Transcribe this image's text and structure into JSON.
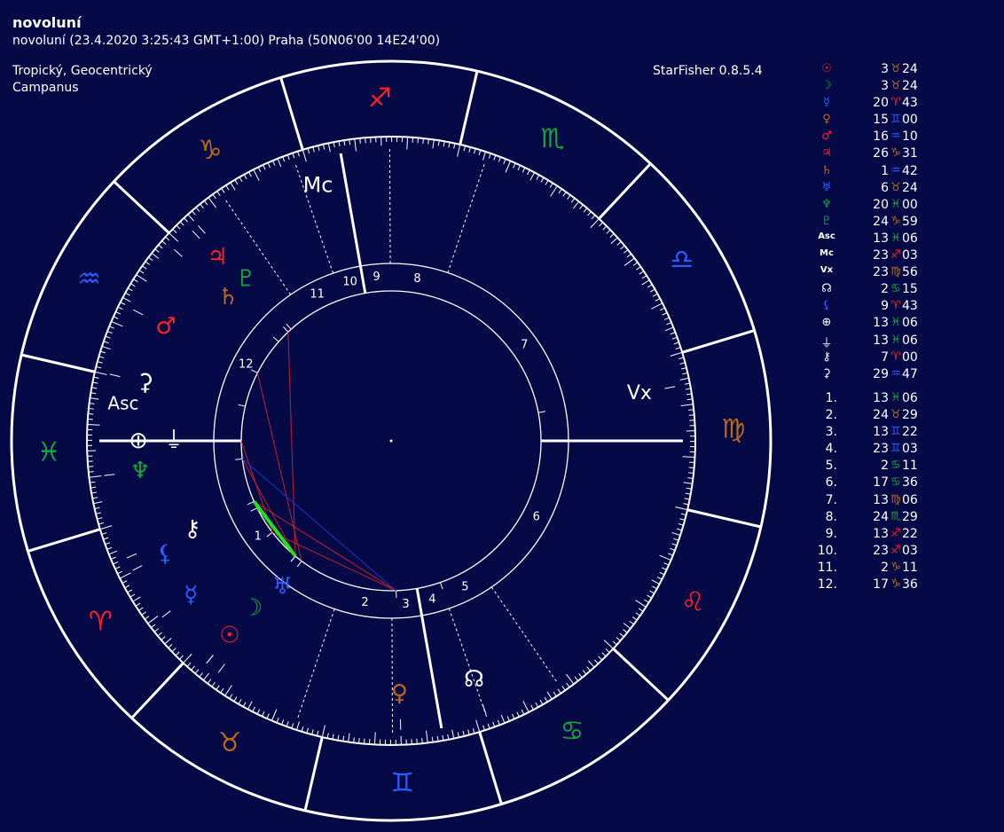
{
  "header": {
    "title": "novoluní",
    "subtitle": "novoluní  (23.4.2020 3:25:43 GMT+1:00) Praha (50N06'00 14E24'00)",
    "zodiac_system": "Tropický, Geocentrický",
    "house_system": "Campanus",
    "app": "StarFisher 0.8.5.4"
  },
  "colors": {
    "background": "#050a46",
    "fire": "#ff2020",
    "earth": "#b86a1a",
    "air": "#2a5cff",
    "water": "#16a63a",
    "aspect_hard": "#c0202a",
    "aspect_soft": "#2030c8",
    "aspect_conj": "#22e022"
  },
  "signs": [
    {
      "glyph": "♈",
      "name": "Beran",
      "color": "#ff2020"
    },
    {
      "glyph": "♉",
      "name": "Býk",
      "color": "#b86a1a"
    },
    {
      "glyph": "♊",
      "name": "Blíženci",
      "color": "#2a5cff"
    },
    {
      "glyph": "♋",
      "name": "Rak",
      "color": "#16a63a"
    },
    {
      "glyph": "♌",
      "name": "Lev",
      "color": "#ff2020"
    },
    {
      "glyph": "♍",
      "name": "Panna",
      "color": "#b86a1a"
    },
    {
      "glyph": "♎",
      "name": "Váhy",
      "color": "#2a5cff"
    },
    {
      "glyph": "♏",
      "name": "Štír",
      "color": "#16a63a"
    },
    {
      "glyph": "♐",
      "name": "Střelec",
      "color": "#ff2020"
    },
    {
      "glyph": "♑",
      "name": "Kozoroh",
      "color": "#b86a1a"
    },
    {
      "glyph": "♒",
      "name": "Vodnář",
      "color": "#2a5cff"
    },
    {
      "glyph": "♓",
      "name": "Ryby",
      "color": "#16a63a"
    }
  ],
  "planets": [
    {
      "name": "Slunce",
      "glyph": "☉",
      "color": "#ff2020",
      "deg": "3",
      "sign": "♉",
      "sign_color": "#b86a1a",
      "min": "24",
      "lon": 33.4,
      "icon": "sun-icon"
    },
    {
      "name": "Měsíc",
      "glyph": "☽",
      "color": "#16a63a",
      "deg": "3",
      "sign": "♉",
      "sign_color": "#b86a1a",
      "min": "24",
      "lon": 33.4,
      "icon": "moon-icon"
    },
    {
      "name": "Merkur",
      "glyph": "☿",
      "color": "#2a5cff",
      "deg": "20",
      "sign": "♈",
      "sign_color": "#ff2020",
      "min": "43",
      "lon": 20.72,
      "icon": "mercury-icon"
    },
    {
      "name": "Venuše",
      "glyph": "♀",
      "color": "#b86a1a",
      "deg": "15",
      "sign": "♊",
      "sign_color": "#2a5cff",
      "min": "00",
      "lon": 75.0,
      "icon": "venus-icon"
    },
    {
      "name": "Mars",
      "glyph": "♂",
      "color": "#ff2020",
      "deg": "16",
      "sign": "♒",
      "sign_color": "#2a5cff",
      "min": "10",
      "lon": 316.17,
      "icon": "mars-icon"
    },
    {
      "name": "Jupiter",
      "glyph": "♃",
      "color": "#ff2020",
      "deg": "26",
      "sign": "♑",
      "sign_color": "#b86a1a",
      "min": "31",
      "lon": 296.52,
      "icon": "jupiter-icon"
    },
    {
      "name": "Saturn",
      "glyph": "♄",
      "color": "#b86a1a",
      "deg": "1",
      "sign": "♒",
      "sign_color": "#2a5cff",
      "min": "42",
      "lon": 301.7,
      "icon": "saturn-icon"
    },
    {
      "name": "Uran",
      "glyph": "♅",
      "color": "#2a5cff",
      "deg": "6",
      "sign": "♉",
      "sign_color": "#b86a1a",
      "min": "24",
      "lon": 36.4,
      "icon": "uranus-icon"
    },
    {
      "name": "Neptun",
      "glyph": "♆",
      "color": "#16a63a",
      "deg": "20",
      "sign": "♓",
      "sign_color": "#16a63a",
      "min": "00",
      "lon": 350.0,
      "icon": "neptune-icon"
    },
    {
      "name": "Pluto",
      "glyph": "♇",
      "color": "#16a63a",
      "deg": "24",
      "sign": "♑",
      "sign_color": "#b86a1a",
      "min": "59",
      "lon": 294.98,
      "icon": "pluto-icon"
    },
    {
      "name": "Asc",
      "glyph": "Asc",
      "color": "#ffffff",
      "deg": "13",
      "sign": "♓",
      "sign_color": "#16a63a",
      "min": "06",
      "lon": 343.1,
      "icon": "ascendant-icon"
    },
    {
      "name": "Mc",
      "glyph": "Mc",
      "color": "#ffffff",
      "deg": "23",
      "sign": "♐",
      "sign_color": "#ff2020",
      "min": "03",
      "lon": 263.05,
      "icon": "midheaven-icon"
    },
    {
      "name": "Vx",
      "glyph": "Vx",
      "color": "#ffffff",
      "deg": "23",
      "sign": "♍",
      "sign_color": "#b86a1a",
      "min": "56",
      "lon": 173.93,
      "icon": "vertex-icon"
    },
    {
      "name": "Uzel",
      "glyph": "☊",
      "color": "#ffffff",
      "deg": "2",
      "sign": "♋",
      "sign_color": "#16a63a",
      "min": "15",
      "lon": 92.25,
      "icon": "north-node-icon"
    },
    {
      "name": "Lilith",
      "glyph": "⚸",
      "color": "#2a5cff",
      "deg": "9",
      "sign": "♈",
      "sign_color": "#ff2020",
      "min": "43",
      "lon": 9.72,
      "icon": "lilith-icon"
    },
    {
      "name": "Fortuna",
      "glyph": "⊕",
      "color": "#ffffff",
      "deg": "13",
      "sign": "♓",
      "sign_color": "#16a63a",
      "min": "06",
      "lon": 343.1,
      "icon": "fortune-icon"
    },
    {
      "name": "Východ",
      "glyph": "⏚",
      "color": "#ffffff",
      "deg": "13",
      "sign": "♓",
      "sign_color": "#16a63a",
      "min": "06",
      "lon": 343.1,
      "icon": "earth-point-icon"
    },
    {
      "name": "Chiron",
      "glyph": "⚷",
      "color": "#ffffff",
      "deg": "7",
      "sign": "♈",
      "sign_color": "#ff2020",
      "min": "00",
      "lon": 7.0,
      "icon": "chiron-icon"
    },
    {
      "name": "Transpluto",
      "glyph": "⚳",
      "color": "#ffffff",
      "deg": "29",
      "sign": "♒",
      "sign_color": "#2a5cff",
      "min": "47",
      "lon": 329.78,
      "icon": "transpluto-icon"
    }
  ],
  "houses": [
    {
      "label": "1.",
      "num": "1",
      "deg": "13",
      "sign": "♓",
      "sign_color": "#16a63a",
      "min": "06",
      "lon": 343.1
    },
    {
      "label": "2.",
      "num": "2",
      "deg": "24",
      "sign": "♉",
      "sign_color": "#b86a1a",
      "min": "29",
      "lon": 54.48
    },
    {
      "label": "3.",
      "num": "3",
      "deg": "13",
      "sign": "♊",
      "sign_color": "#2a5cff",
      "min": "22",
      "lon": 73.37
    },
    {
      "label": "4.",
      "num": "4",
      "deg": "23",
      "sign": "♊",
      "sign_color": "#2a5cff",
      "min": "03",
      "lon": 83.05
    },
    {
      "label": "5.",
      "num": "5",
      "deg": "2",
      "sign": "♋",
      "sign_color": "#16a63a",
      "min": "11",
      "lon": 92.18
    },
    {
      "label": "6.",
      "num": "6",
      "deg": "17",
      "sign": "♋",
      "sign_color": "#16a63a",
      "min": "36",
      "lon": 107.6
    },
    {
      "label": "7.",
      "num": "7",
      "deg": "13",
      "sign": "♍",
      "sign_color": "#b86a1a",
      "min": "06",
      "lon": 163.1
    },
    {
      "label": "8.",
      "num": "8",
      "deg": "24",
      "sign": "♏",
      "sign_color": "#16a63a",
      "min": "29",
      "lon": 234.48
    },
    {
      "label": "9.",
      "num": "9",
      "deg": "13",
      "sign": "♐",
      "sign_color": "#ff2020",
      "min": "22",
      "lon": 253.37
    },
    {
      "label": "10.",
      "num": "10",
      "deg": "23",
      "sign": "♐",
      "sign_color": "#ff2020",
      "min": "03",
      "lon": 263.05
    },
    {
      "label": "11.",
      "num": "11",
      "deg": "2",
      "sign": "♑",
      "sign_color": "#b86a1a",
      "min": "11",
      "lon": 272.18
    },
    {
      "label": "12.",
      "num": "12",
      "deg": "17",
      "sign": "♑",
      "sign_color": "#b86a1a",
      "min": "36",
      "lon": 287.6
    }
  ],
  "aspects": [
    {
      "from": 0,
      "to": 1,
      "type": "conj"
    },
    {
      "from": 0,
      "to": 8,
      "type": "hard"
    },
    {
      "from": 0,
      "to": 14,
      "type": "hard"
    },
    {
      "from": 1,
      "to": 5,
      "type": "hard"
    },
    {
      "from": 7,
      "to": 4,
      "type": "hard"
    },
    {
      "from": 3,
      "to": 17,
      "type": "hard"
    },
    {
      "from": 2,
      "to": 3,
      "type": "hard"
    },
    {
      "from": 2,
      "to": 10,
      "type": "hard"
    },
    {
      "from": 3,
      "to": 8,
      "type": "soft"
    },
    {
      "from": 17,
      "to": 0,
      "type": "conj"
    }
  ],
  "house_numbers": [
    "1",
    "2",
    "3",
    "4",
    "5",
    "6",
    "7",
    "8",
    "9",
    "10",
    "11",
    "12"
  ]
}
